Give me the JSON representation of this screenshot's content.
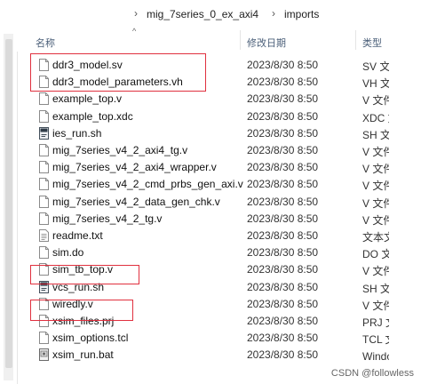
{
  "breadcrumb": [
    "mig_7series_0_ex_axi4",
    "imports"
  ],
  "columns": {
    "name": "名称",
    "date": "修改日期",
    "type": "类型"
  },
  "files": [
    {
      "name": "ddr3_model.sv",
      "date": "2023/8/30 8:50",
      "type": "SV 文件",
      "icon": "doc-icon"
    },
    {
      "name": "ddr3_model_parameters.vh",
      "date": "2023/8/30 8:50",
      "type": "VH 文件",
      "icon": "doc-icon"
    },
    {
      "name": "example_top.v",
      "date": "2023/8/30 8:50",
      "type": "V 文件",
      "icon": "doc-icon"
    },
    {
      "name": "example_top.xdc",
      "date": "2023/8/30 8:50",
      "type": "XDC 文件",
      "icon": "doc-icon"
    },
    {
      "name": "ies_run.sh",
      "date": "2023/8/30 8:50",
      "type": "SH 文件",
      "icon": "script-icon"
    },
    {
      "name": "mig_7series_v4_2_axi4_tg.v",
      "date": "2023/8/30 8:50",
      "type": "V 文件",
      "icon": "doc-icon"
    },
    {
      "name": "mig_7series_v4_2_axi4_wrapper.v",
      "date": "2023/8/30 8:50",
      "type": "V 文件",
      "icon": "doc-icon"
    },
    {
      "name": "mig_7series_v4_2_cmd_prbs_gen_axi.v",
      "date": "2023/8/30 8:50",
      "type": "V 文件",
      "icon": "doc-icon"
    },
    {
      "name": "mig_7series_v4_2_data_gen_chk.v",
      "date": "2023/8/30 8:50",
      "type": "V 文件",
      "icon": "doc-icon"
    },
    {
      "name": "mig_7series_v4_2_tg.v",
      "date": "2023/8/30 8:50",
      "type": "V 文件",
      "icon": "doc-icon"
    },
    {
      "name": "readme.txt",
      "date": "2023/8/30 8:50",
      "type": "文本文档",
      "icon": "text-icon"
    },
    {
      "name": "sim.do",
      "date": "2023/8/30 8:50",
      "type": "DO 文件",
      "icon": "doc-icon"
    },
    {
      "name": "sim_tb_top.v",
      "date": "2023/8/30 8:50",
      "type": "V 文件",
      "icon": "doc-icon"
    },
    {
      "name": "vcs_run.sh",
      "date": "2023/8/30 8:50",
      "type": "SH 文件",
      "icon": "script-icon"
    },
    {
      "name": "wiredly.v",
      "date": "2023/8/30 8:50",
      "type": "V 文件",
      "icon": "doc-icon"
    },
    {
      "name": "xsim_files.prj",
      "date": "2023/8/30 8:50",
      "type": "PRJ 文件",
      "icon": "doc-icon"
    },
    {
      "name": "xsim_options.tcl",
      "date": "2023/8/30 8:50",
      "type": "TCL 文件",
      "icon": "doc-icon"
    },
    {
      "name": "xsim_run.bat",
      "date": "2023/8/30 8:50",
      "type": "Windows 批处理文件",
      "icon": "bat-icon"
    }
  ],
  "watermark": "CSDN @followless",
  "colors": {
    "highlight": "#e0303f",
    "header_text": "#4c607a"
  }
}
